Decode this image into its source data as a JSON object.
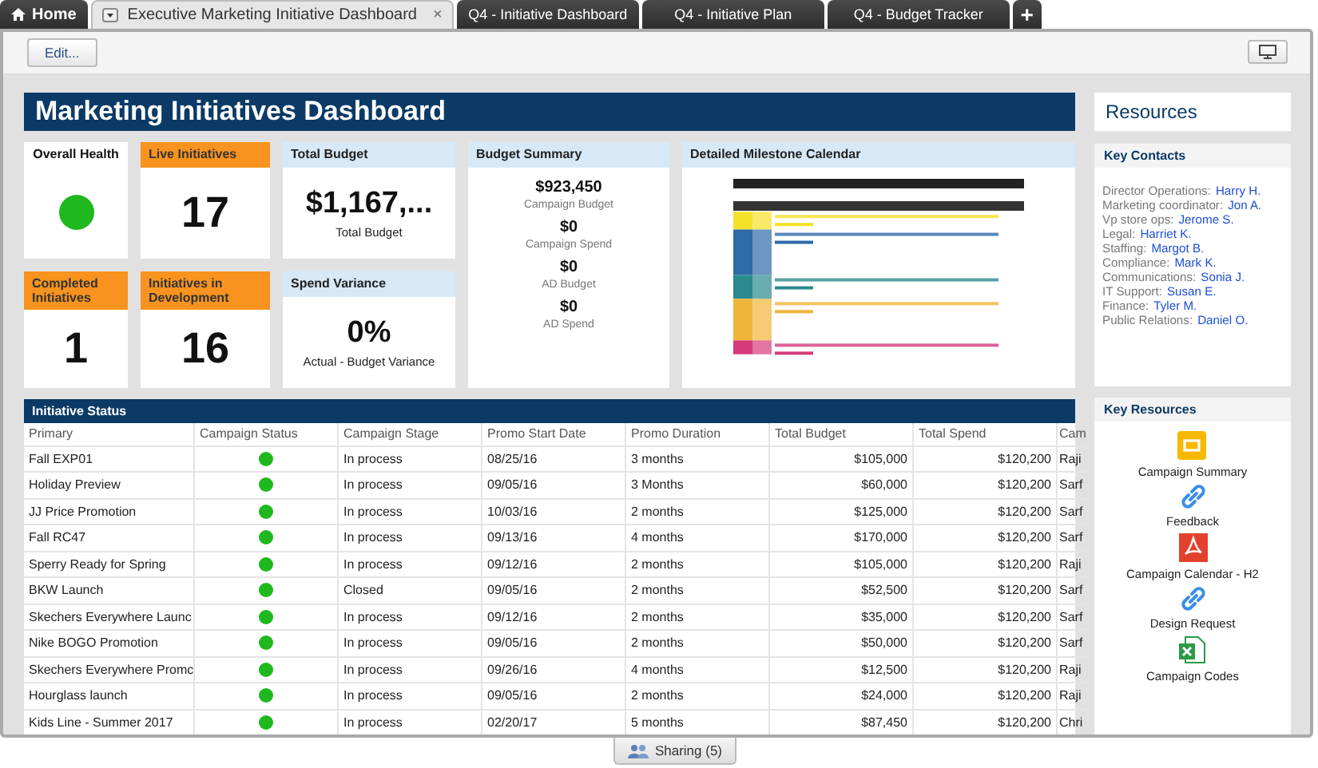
{
  "tabs": [
    {
      "kind": "home",
      "label": "Home",
      "selected": false
    },
    {
      "kind": "sheet",
      "label": "Executive Marketing Initiative Dashboard",
      "close": "×",
      "selected": true
    },
    {
      "kind": "sheet",
      "label": "Q4 - Initiative Dashboard",
      "selected": false
    },
    {
      "kind": "sheet",
      "label": "Q4 - Initiative Plan",
      "selected": false
    },
    {
      "kind": "sheet",
      "label": "Q4 - Budget Tracker",
      "selected": false
    },
    {
      "kind": "add",
      "label": "+",
      "selected": false
    }
  ],
  "toolbar": {
    "edit_button": "Edit..."
  },
  "dashboard": {
    "title": "Marketing Initiatives Dashboard",
    "tiles": [
      {
        "kind": "health",
        "title": "Overall Health",
        "color": "#1fb81f"
      },
      {
        "kind": "metric",
        "title": "Live Initiatives",
        "value": "17"
      },
      {
        "kind": "budget",
        "title": "Total Budget",
        "value": "$1,167,...",
        "caption": "Total Budget"
      },
      {
        "kind": "summary",
        "title": "Budget Summary",
        "items": [
          {
            "value": "$923,450",
            "caption": "Campaign Budget"
          },
          {
            "value": "$0",
            "caption": "Campaign Spend"
          },
          {
            "value": "$0",
            "caption": "AD Budget"
          },
          {
            "value": "$0",
            "caption": "AD Spend"
          }
        ]
      },
      {
        "kind": "calendar",
        "title": "Detailed Milestone Calendar"
      },
      {
        "kind": "metric",
        "title": "Completed Initiatives",
        "value": "1"
      },
      {
        "kind": "metric",
        "title": "Initiatives in Development",
        "value": "16"
      },
      {
        "kind": "budget",
        "title": "Spend Variance",
        "value": "0%",
        "caption": "Actual - Budget Variance"
      }
    ]
  },
  "table": {
    "title": "Initiative Status",
    "columns": [
      "Primary",
      "Campaign Status",
      "Campaign Stage",
      "Promo Start Date",
      "Promo Duration",
      "Total Budget",
      "Total Spend",
      "Cam"
    ],
    "rows": [
      {
        "primary": "Fall EXP01",
        "color": "#1fb81f",
        "stage": "In process",
        "start": "08/25/16",
        "duration": "3 months",
        "budget": "$105,000",
        "spend": "$120,200",
        "column_8": "Raji"
      },
      {
        "primary": "Holiday Preview",
        "color": "#1fb81f",
        "stage": "In process",
        "start": "09/05/16",
        "duration": "3 Months",
        "budget": "$60,000",
        "spend": "$120,200",
        "column_8": "Sarf"
      },
      {
        "primary": "JJ Price Promotion",
        "color": "#1fb81f",
        "stage": "In process",
        "start": "10/03/16",
        "duration": "2 months",
        "budget": "$125,000",
        "spend": "$120,200",
        "column_8": "Sarf"
      },
      {
        "primary": "Fall RC47",
        "color": "#1fb81f",
        "stage": "In process",
        "start": "09/13/16",
        "duration": "4 months",
        "budget": "$170,000",
        "spend": "$120,200",
        "column_8": "Sarf"
      },
      {
        "primary": "Sperry Ready for Spring",
        "color": "#1fb81f",
        "stage": "In process",
        "start": "09/12/16",
        "duration": "2 months",
        "budget": "$105,000",
        "spend": "$120,200",
        "column_8": "Raji"
      },
      {
        "primary": "BKW Launch",
        "color": "#1fb81f",
        "stage": "Closed",
        "start": "09/05/16",
        "duration": "2 months",
        "budget": "$52,500",
        "spend": "$120,200",
        "column_8": "Sarf"
      },
      {
        "primary": "Skechers Everywhere Launc",
        "color": "#1fb81f",
        "stage": "In process",
        "start": "09/12/16",
        "duration": "2 months",
        "budget": "$35,000",
        "spend": "$120,200",
        "column_8": "Sarf"
      },
      {
        "primary": "Nike BOGO Promotion",
        "color": "#1fb81f",
        "stage": "In process",
        "start": "09/05/16",
        "duration": "2 months",
        "budget": "$50,000",
        "spend": "$120,200",
        "column_8": "Sarf"
      },
      {
        "primary": "Skechers Everywhere Promc",
        "color": "#1fb81f",
        "stage": "In process",
        "start": "09/26/16",
        "duration": "4 months",
        "budget": "$12,500",
        "spend": "$120,200",
        "column_8": "Raji"
      },
      {
        "primary": "Hourglass launch",
        "color": "#1fb81f",
        "stage": "In process",
        "start": "09/05/16",
        "duration": "2 months",
        "budget": "$24,000",
        "spend": "$120,200",
        "column_8": "Raji"
      },
      {
        "primary": "Kids Line - Summer 2017",
        "color": "#1fb81f",
        "stage": "In process",
        "start": "02/20/17",
        "duration": "5 months",
        "budget": "$87,450",
        "spend": "$120,200",
        "column_8": "Chri"
      }
    ]
  },
  "sidebar": {
    "title": "Resources",
    "contacts": {
      "title": "Key Contacts",
      "items": [
        {
          "role": "Director Operations:",
          "name": "Harry H."
        },
        {
          "role": "Marketing coordinator:",
          "name": "Jon A."
        },
        {
          "role": "Vp store ops:",
          "name": "Jerome S."
        },
        {
          "role": "Legal:",
          "name": "Harriet K."
        },
        {
          "role": "Staffing:",
          "name": "Margot B."
        },
        {
          "role": "Compliance:",
          "name": "Mark K."
        },
        {
          "role": "Communications:",
          "name": "Sonia J."
        },
        {
          "role": "IT Support:",
          "name": "Susan E."
        },
        {
          "role": "Finance:",
          "name": "Tyler M."
        },
        {
          "role": "Public Relations:",
          "name": "Daniel O."
        }
      ]
    },
    "resources": {
      "title": "Key Resources",
      "items": [
        {
          "kind": "slides",
          "label": "Campaign Summary"
        },
        {
          "kind": "link",
          "label": "Feedback"
        },
        {
          "kind": "pdf",
          "label": "Campaign Calendar - H2"
        },
        {
          "kind": "link",
          "label": "Design Request"
        },
        {
          "kind": "sheet",
          "label": "Campaign Codes"
        }
      ]
    }
  },
  "sharing": {
    "label": "Sharing (5)"
  }
}
